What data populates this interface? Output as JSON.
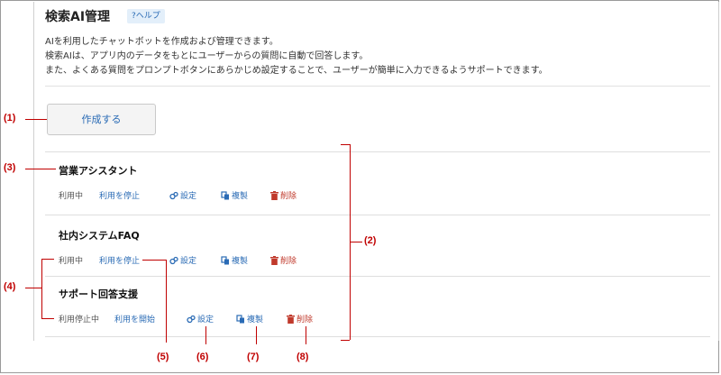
{
  "page": {
    "title": "検索AI管理",
    "help_label": "?ヘルプ",
    "description": [
      "AIを利用したチャットボットを作成および管理できます。",
      "検索AIは、アプリ内のデータをもとにユーザーからの質問に自動で回答します。",
      "また、よくある質問をプロンプトボタンにあらかじめ設定することで、ユーザーが簡単に入力できるようサポートできます。"
    ],
    "create_button": "作成する"
  },
  "bots": [
    {
      "name": "営業アシスタント",
      "status": "利用中",
      "toggle": "利用を停止",
      "settings": "設定",
      "copy": "複製",
      "delete": "削除"
    },
    {
      "name": "社内システムFAQ",
      "status": "利用中",
      "toggle": "利用を停止",
      "settings": "設定",
      "copy": "複製",
      "delete": "削除"
    },
    {
      "name": "サポート回答支援",
      "status": "利用停止中",
      "toggle": "利用を開始",
      "settings": "設定",
      "copy": "複製",
      "delete": "削除"
    }
  ],
  "annotations": [
    "(1)",
    "(2)",
    "(3)",
    "(4)",
    "(5)",
    "(6)",
    "(7)",
    "(8)"
  ],
  "colors": {
    "link": "#2a6bb5",
    "delete": "#c0392b",
    "annotation": "#c00000"
  }
}
